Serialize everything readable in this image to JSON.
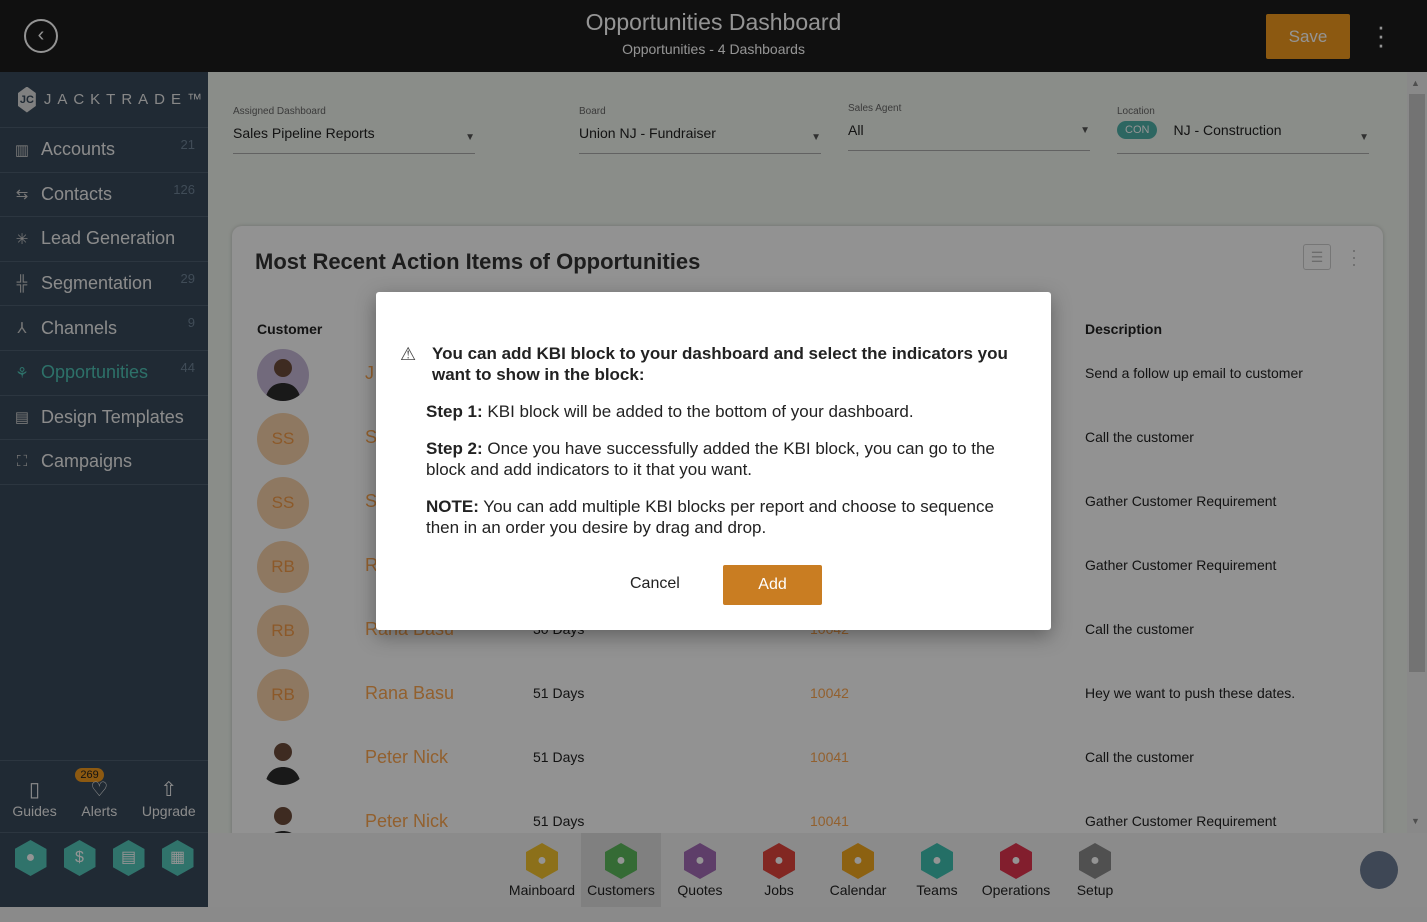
{
  "header": {
    "title": "Opportunities Dashboard",
    "subtitle": "Opportunities - 4 Dashboards",
    "save_label": "Save"
  },
  "sidebar": {
    "brand": "JACKTRADE™",
    "items": [
      {
        "label": "Accounts",
        "count": "21",
        "icon": "building-icon"
      },
      {
        "label": "Contacts",
        "count": "126",
        "icon": "contacts-icon"
      },
      {
        "label": "Lead Generation",
        "count": "",
        "icon": "lead-icon"
      },
      {
        "label": "Segmentation",
        "count": "29",
        "icon": "segmentation-icon"
      },
      {
        "label": "Channels",
        "count": "9",
        "icon": "channels-icon"
      },
      {
        "label": "Opportunities",
        "count": "44",
        "icon": "opportunities-icon",
        "active": true
      },
      {
        "label": "Design Templates",
        "count": "",
        "icon": "templates-icon"
      },
      {
        "label": "Campaigns",
        "count": "",
        "icon": "campaigns-icon"
      }
    ],
    "utilities": {
      "guides": "Guides",
      "alerts": "Alerts",
      "alerts_count": "269",
      "upgrade": "Upgrade"
    }
  },
  "filters": {
    "assigned_dashboard": {
      "label": "Assigned Dashboard",
      "value": "Sales Pipeline Reports"
    },
    "board": {
      "label": "Board",
      "value": "Union NJ - Fundraiser"
    },
    "sales_agent": {
      "label": "Sales Agent",
      "value": "All"
    },
    "location": {
      "label": "Location",
      "badge": "CON",
      "value": "NJ - Construction"
    }
  },
  "card": {
    "title": "Most Recent Action Items of Opportunities",
    "columns": {
      "customer": "Customer",
      "description": "Description"
    },
    "rows": [
      {
        "initials": "",
        "name": "J",
        "days": "",
        "id": "",
        "description": "Send a follow up email to customer"
      },
      {
        "initials": "SS",
        "name": "S",
        "days": "",
        "id": "",
        "description": "Call the customer"
      },
      {
        "initials": "SS",
        "name": "S",
        "days": "",
        "id": "",
        "description": "Gather Customer Requirement"
      },
      {
        "initials": "RB",
        "name": "R",
        "days": "",
        "id": "",
        "description": "Gather Customer Requirement"
      },
      {
        "initials": "RB",
        "name": "Rana Basu",
        "days": "30 Days",
        "id": "10042",
        "description": "Call the customer"
      },
      {
        "initials": "RB",
        "name": "Rana Basu",
        "days": "51 Days",
        "id": "10042",
        "description": "Hey we want to push these dates."
      },
      {
        "initials": "",
        "name": "Peter Nick",
        "days": "51 Days",
        "id": "10041",
        "description": "Call the customer"
      },
      {
        "initials": "",
        "name": "Peter Nick",
        "days": "51 Days",
        "id": "10041",
        "description": "Gather Customer Requirement"
      }
    ]
  },
  "apps": [
    {
      "label": "Mainboard",
      "color": "#f2c12e"
    },
    {
      "label": "Customers",
      "color": "#5cb85c",
      "selected": true
    },
    {
      "label": "Quotes",
      "color": "#a36bb5"
    },
    {
      "label": "Jobs",
      "color": "#e0443c"
    },
    {
      "label": "Calendar",
      "color": "#f2a81e"
    },
    {
      "label": "Teams",
      "color": "#3fbfb0"
    },
    {
      "label": "Operations",
      "color": "#e0344f"
    },
    {
      "label": "Setup",
      "color": "#8a8a8a"
    }
  ],
  "modal": {
    "heading": "You can add KBI block to your dashboard and select the indicators you want to show in the block:",
    "step1_label": "Step 1:",
    "step1_text": " KBI block will be added to the bottom of your dashboard.",
    "step2_label": "Step 2:",
    "step2_text": " Once you have successfully added the KBI block, you can go to the block and add indicators to it that you want.",
    "note_label": "NOTE:",
    "note_text": " You can add multiple KBI blocks per report and choose to sequence then in an order you desire by drag and drop.",
    "cancel_label": "Cancel",
    "add_label": "Add"
  },
  "colors": {
    "accent": "#c97d22",
    "active_nav": "#4fc3b5"
  }
}
